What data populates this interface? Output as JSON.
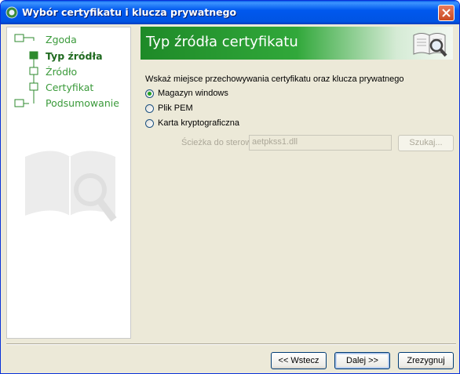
{
  "window": {
    "title": "Wybór certyfikatu i klucza prywatnego"
  },
  "steps": [
    {
      "label": "Zgoda",
      "active": false
    },
    {
      "label": "Typ źródła",
      "active": true
    },
    {
      "label": "Źródło",
      "active": false
    },
    {
      "label": "Certyfikat",
      "active": false
    },
    {
      "label": "Podsumowanie",
      "active": false
    }
  ],
  "header": {
    "title": "Typ źródła certyfikatu"
  },
  "form": {
    "prompt": "Wskaż miejsce przechowywania certyfikatu oraz klucza prywatnego",
    "options": [
      {
        "label": "Magazyn windows",
        "selected": true
      },
      {
        "label": "Plik PEM",
        "selected": false
      },
      {
        "label": "Karta kryptograficzna",
        "selected": false
      }
    ],
    "driver_path_label": "Ścieżka do sterownika:",
    "driver_path_value": "aetpkss1.dll",
    "search_label": "Szukaj..."
  },
  "buttons": {
    "back": "<< Wstecz",
    "next": "Dalej >>",
    "cancel": "Zrezygnuj"
  },
  "colors": {
    "accent_green": "#31a83a",
    "titlebar_blue": "#0054e3"
  }
}
